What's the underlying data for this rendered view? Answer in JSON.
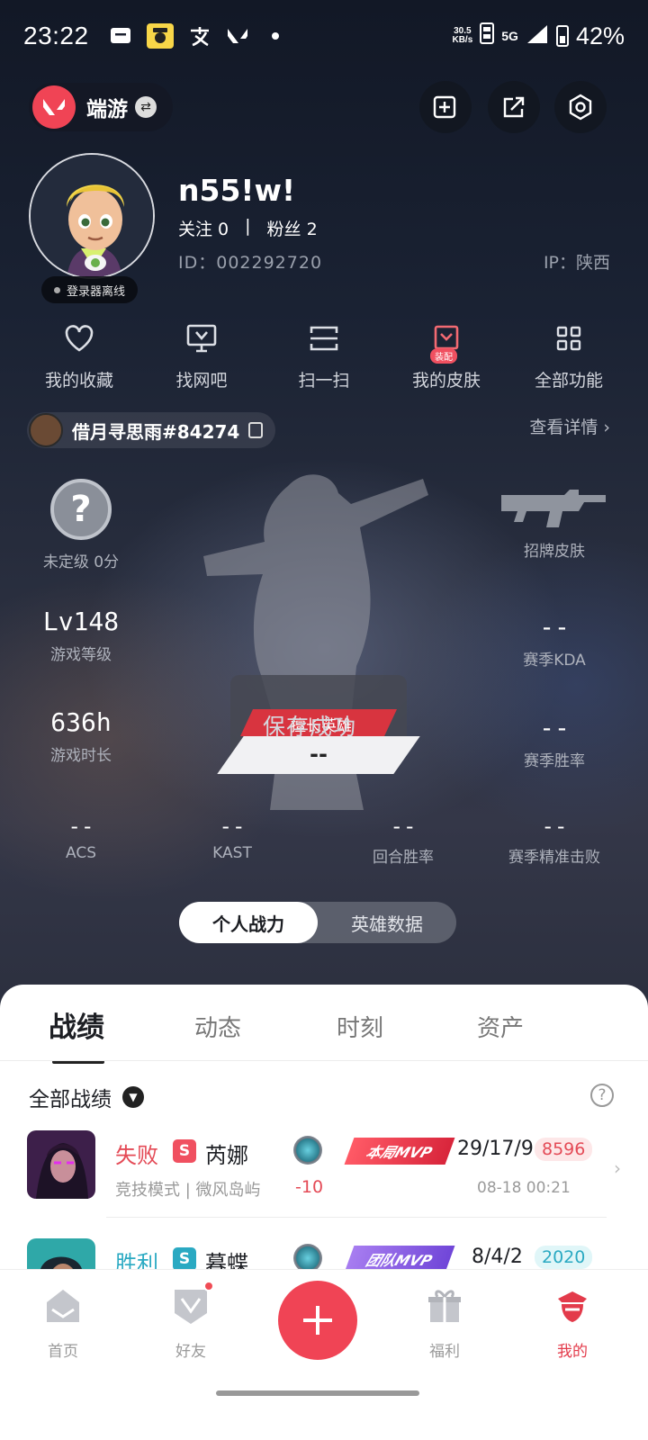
{
  "status_bar": {
    "time": "23:22",
    "net_speed_value": "30.5",
    "net_speed_unit": "KB/s",
    "network": "5G",
    "battery": "42%",
    "notification_icons": [
      "message-icon",
      "yellow-app-icon",
      "alipay-icon",
      "valorant-icon",
      "dot-icon"
    ]
  },
  "header": {
    "game_label": "端游",
    "buttons": [
      "edit-card-icon",
      "share-icon",
      "settings-hex-icon"
    ]
  },
  "profile": {
    "nickname": "n55!w!",
    "following_label": "关注 0",
    "divider": "|",
    "fans_label": "粉丝 2",
    "id_label": "ID：002292720",
    "ip_label": "IP：陕西",
    "status": "登录器离线"
  },
  "features": [
    {
      "label": "我的收藏",
      "icon": "heart-icon"
    },
    {
      "label": "找网吧",
      "icon": "monitor-icon"
    },
    {
      "label": "扫一扫",
      "icon": "scan-icon"
    },
    {
      "label": "我的皮肤",
      "icon": "skin-icon",
      "badge": "装配"
    },
    {
      "label": "全部功能",
      "icon": "grid-icon"
    }
  ],
  "account": {
    "name": "借月寻思雨#84274",
    "details_link": "查看详情 ›"
  },
  "stats": {
    "rank": {
      "icon_text": "?",
      "label": "未定级 0分"
    },
    "skin": {
      "label": "招牌皮肤"
    },
    "level": {
      "value": "Lv148",
      "label": "游戏等级"
    },
    "kda": {
      "value": "--",
      "label": "赛季KDA"
    },
    "playtime": {
      "value": "636h",
      "label": "游戏时长"
    },
    "winrate": {
      "value": "--",
      "label": "赛季胜率"
    },
    "acs": {
      "value": "--",
      "label": "ACS"
    },
    "kast": {
      "value": "--",
      "label": "KAST"
    },
    "round_winrate": {
      "value": "--",
      "label": "回合胜率"
    },
    "precision": {
      "value": "--",
      "label": "赛季精准击败"
    },
    "hero_label": "擅长英雄",
    "hero_value": "--",
    "toast": "保存成功"
  },
  "toggle": {
    "options": [
      "个人战力",
      "英雄数据"
    ],
    "active": 0
  },
  "tabs": {
    "items": [
      "战绩",
      "动态",
      "时刻",
      "资产"
    ],
    "active": 0
  },
  "filter": {
    "label": "全部战绩"
  },
  "matches": [
    {
      "result": "失败",
      "result_color": "#e44a56",
      "agent": "芮娜",
      "mode": "竞技模式 | 微风岛屿",
      "rank_delta": "-10",
      "mvp": "本局MVP",
      "kda": "29/17/9",
      "score": "8596",
      "datetime": "08-18 00:21"
    },
    {
      "result": "胜利",
      "result_color": "#2aa9c2",
      "agent": "暮蝶",
      "mvp": "团队MVP",
      "kda": "8/4/2",
      "score": "2020"
    }
  ],
  "bottom_nav": {
    "items": [
      {
        "label": "首页",
        "icon": "home-icon"
      },
      {
        "label": "好友",
        "icon": "friends-icon"
      },
      {
        "label": "福利",
        "icon": "gift-icon"
      },
      {
        "label": "我的",
        "icon": "profile-icon"
      }
    ],
    "active": 3,
    "center_button": "plus-icon"
  },
  "colors": {
    "accent": "#f04455",
    "lose": "#e44a56",
    "win": "#2aa9c2"
  }
}
